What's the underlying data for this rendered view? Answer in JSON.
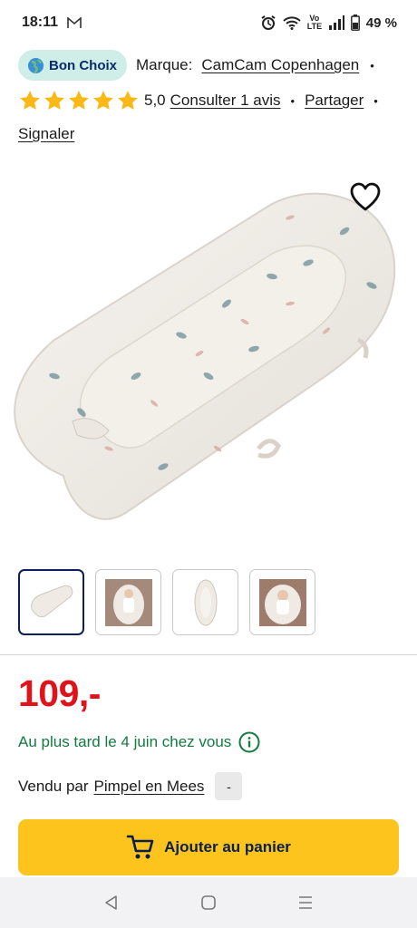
{
  "status": {
    "time": "18:11",
    "battery": "49 %",
    "network_label": "Vo LTE"
  },
  "product": {
    "badge": "Bon Choix",
    "brand_prefix": "Marque:",
    "brand": "CamCam Copenhagen",
    "rating": 5,
    "rating_text": "5,0",
    "reviews_link": "Consulter 1 avis",
    "share": "Partager",
    "report": "Signaler",
    "separator": "•"
  },
  "price": "109,-",
  "delivery": "Au plus tard le 4 juin chez vous",
  "seller": {
    "prefix": "Vendu par",
    "name": "Pimpel en Mees",
    "score": "-"
  },
  "cart_button": "Ajouter au panier",
  "colors": {
    "badge_bg": "#cfeee7",
    "price": "#e0131a",
    "delivery": "#137a40",
    "button": "#fcc41c",
    "star": "#fbb916"
  },
  "icons": [
    "mail-icon",
    "alarm-icon",
    "wifi-icon",
    "signal-icon",
    "battery-icon",
    "globe-icon",
    "star-icon",
    "heart-icon",
    "info-icon",
    "cart-icon",
    "back-icon",
    "home-icon",
    "recents-icon"
  ]
}
